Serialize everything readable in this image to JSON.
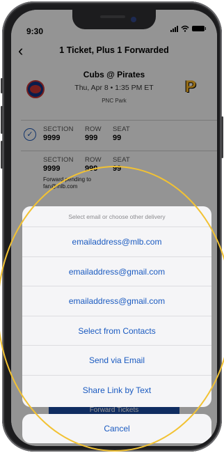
{
  "status_bar": {
    "time": "9:30"
  },
  "nav": {
    "back_icon": "chevron-left-icon",
    "title": "1 Ticket, Plus 1 Forwarded"
  },
  "game": {
    "matchup": "Cubs @ Pirates",
    "date_time": "Thu, Apr 8 • 1:35 PM ET",
    "venue": "PNC Park",
    "home_logo": "pirates-logo",
    "away_logo": "cubs-logo"
  },
  "tickets": [
    {
      "selected": true,
      "section_label": "SECTION",
      "section": "9999",
      "row_label": "ROW",
      "row": "999",
      "seat_label": "SEAT",
      "seat": "99",
      "pending": ""
    },
    {
      "selected": false,
      "section_label": "SECTION",
      "section": "9999",
      "row_label": "ROW",
      "row": "999",
      "seat_label": "SEAT",
      "seat": "99",
      "pending": "Forward pending to fan@mlb.com"
    }
  ],
  "underlying_button": {
    "label": "Forward Tickets"
  },
  "sheet": {
    "header": "Select email or choose other delivery",
    "options": [
      "emailaddress@mlb.com",
      "emailaddress@gmail.com",
      "emailaddress@gmail.com",
      "Select from Contacts",
      "Send via Email",
      "Share Link by Text"
    ],
    "cancel": "Cancel"
  },
  "colors": {
    "accent": "#1a5ac0",
    "highlight": "#f2c233",
    "sheet_bg": "#f5f5f7"
  }
}
